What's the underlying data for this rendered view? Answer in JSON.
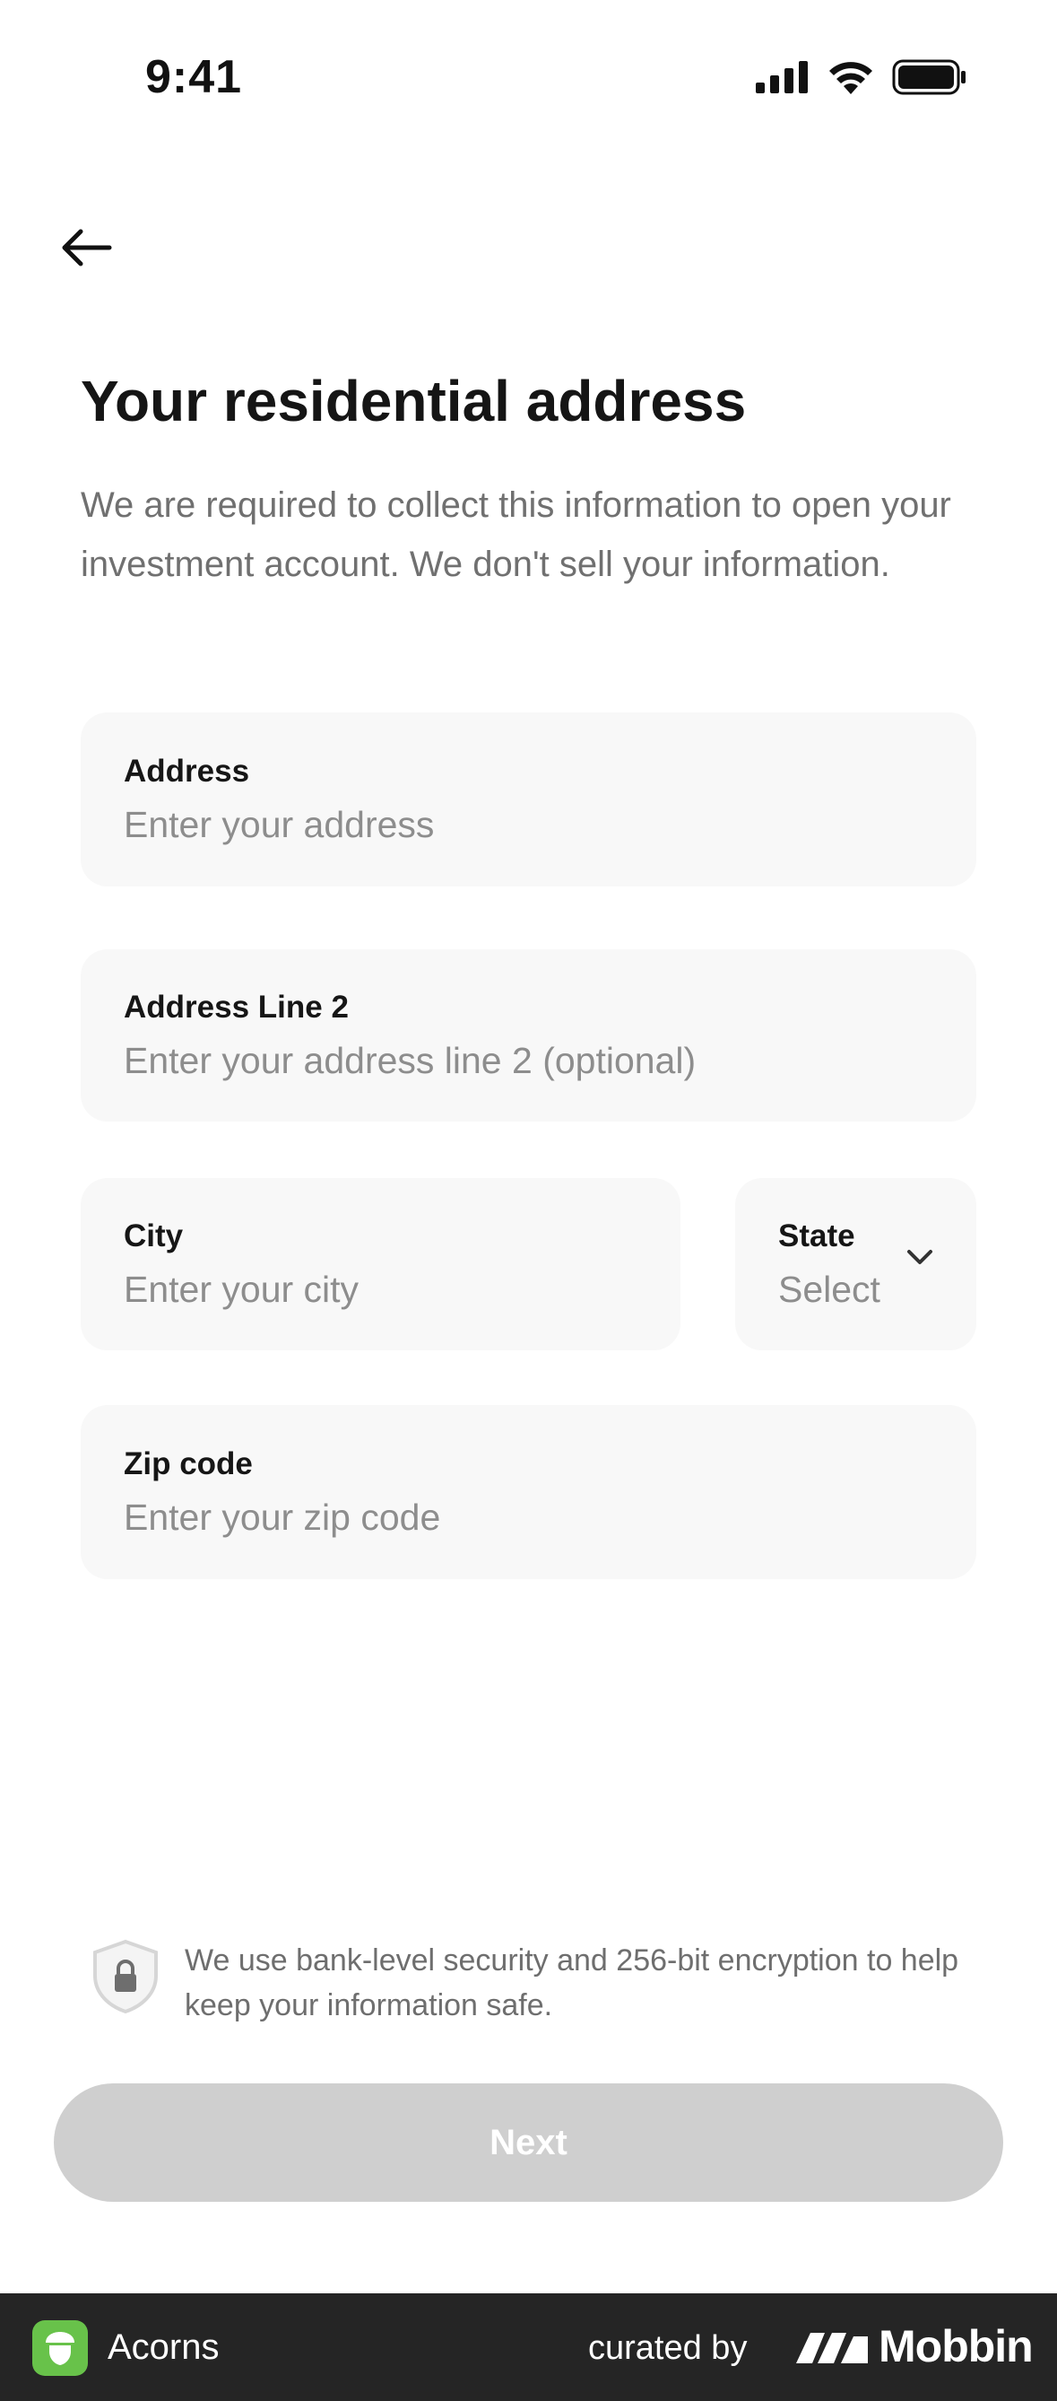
{
  "status_bar": {
    "time": "9:41"
  },
  "header": {
    "title": "Your residential address",
    "subtitle": "We are required to collect this information to open your investment account. We don't sell your information."
  },
  "form": {
    "address": {
      "label": "Address",
      "placeholder": "Enter your address"
    },
    "address_line2": {
      "label": "Address Line 2",
      "placeholder": "Enter your address line 2 (optional)"
    },
    "city": {
      "label": "City",
      "placeholder": "Enter your city"
    },
    "state": {
      "label": "State",
      "value": "Select"
    },
    "zip": {
      "label": "Zip code",
      "placeholder": "Enter your zip code"
    }
  },
  "security": {
    "text": "We use bank-level security and 256-bit encryption to help keep your information safe."
  },
  "actions": {
    "next_label": "Next"
  },
  "footer": {
    "app_name": "Acorns",
    "curated_by": "curated by",
    "brand": "Mobbin"
  },
  "colors": {
    "field_bg": "#f8f8f8",
    "button_disabled": "#cfcfcf",
    "footer_bg": "#252525",
    "acorns_green": "#68c24a"
  }
}
